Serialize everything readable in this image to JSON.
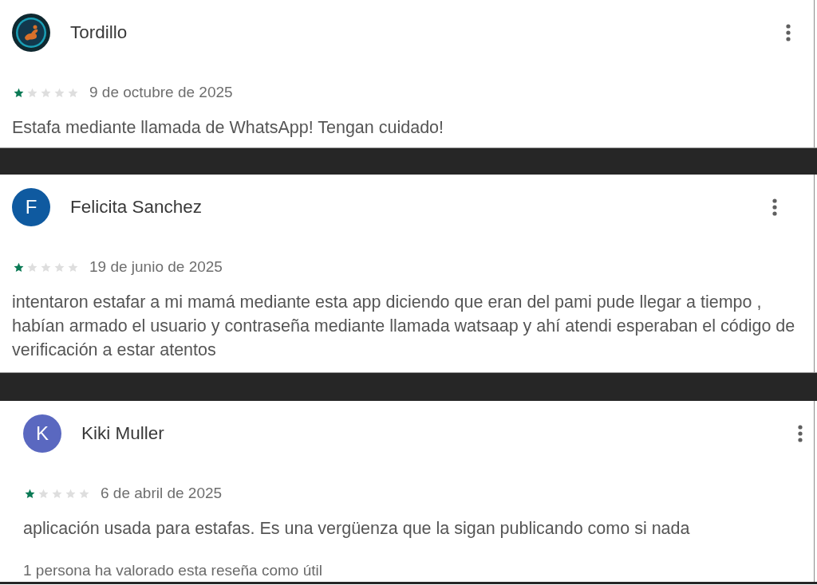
{
  "reviews": [
    {
      "author": "Tordillo",
      "avatar": {
        "kind": "image"
      },
      "stars": 1,
      "date": "9 de octubre de 2025",
      "text": "Estafa mediante llamada de WhatsApp! Tengan cuidado!"
    },
    {
      "author": "Felicita Sanchez",
      "avatar": {
        "kind": "initial",
        "letter": "F",
        "color": "#0f5aa0"
      },
      "stars": 1,
      "date": "19 de junio de 2025",
      "text": "intentaron estafar a mi mamá mediante esta app diciendo que eran del pami pude llegar a tiempo , habían armado el usuario y contraseña mediante llamada watsaap y ahí atendi esperaban el código de verificación a estar atentos"
    },
    {
      "author": "Kiki Muller",
      "avatar": {
        "kind": "initial",
        "letter": "K",
        "color": "#5a68c0"
      },
      "stars": 1,
      "date": "6 de abril de 2025",
      "text": "aplicación usada para estafas. Es una vergüenza que la sigan publicando como si nada",
      "helpful": "1 persona ha valorado esta reseña como útil"
    }
  ]
}
